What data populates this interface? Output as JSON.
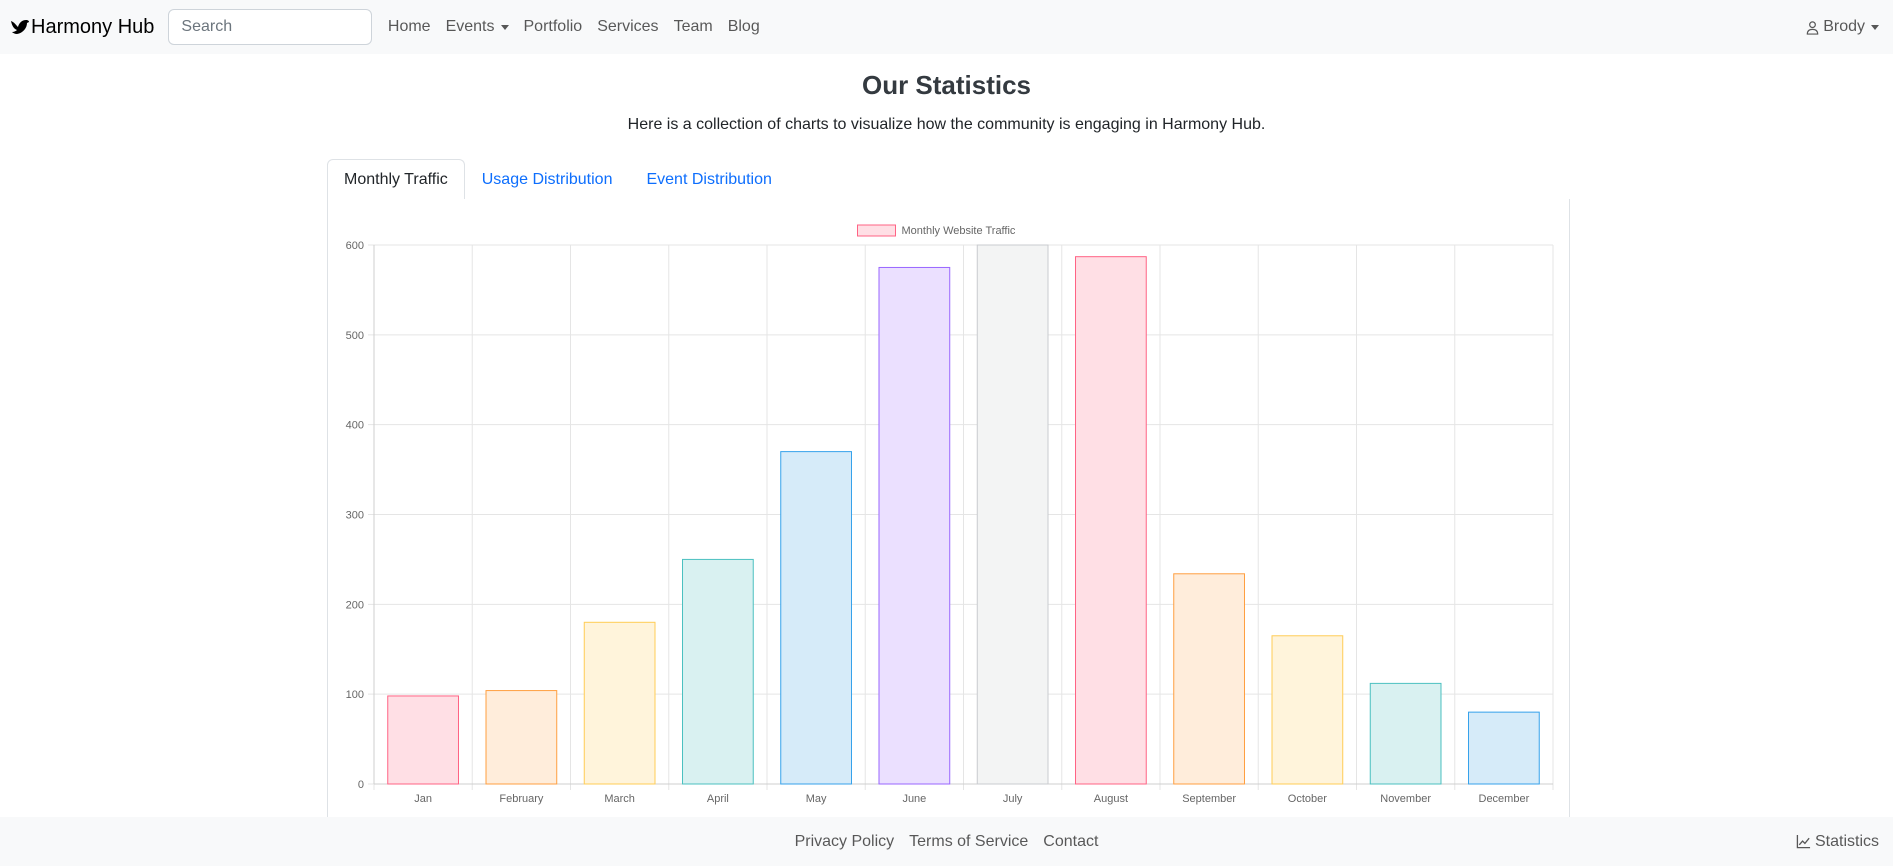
{
  "navbar": {
    "brand": "Harmony Hub",
    "search_placeholder": "Search",
    "links": [
      "Home",
      "Events",
      "Portfolio",
      "Services",
      "Team",
      "Blog"
    ],
    "user": "Brody"
  },
  "header": {
    "title": "Our Statistics",
    "subtitle": "Here is a collection of charts to visualize how the community is engaging in Harmony Hub."
  },
  "tabs": [
    "Monthly Traffic",
    "Usage Distribution",
    "Event Distribution"
  ],
  "footer": {
    "links": [
      "Privacy Policy",
      "Terms of Service",
      "Contact"
    ],
    "statistics": "Statistics"
  },
  "chart_data": {
    "type": "bar",
    "legend": "Monthly Website Traffic",
    "categories": [
      "Jan",
      "February",
      "March",
      "April",
      "May",
      "June",
      "July",
      "August",
      "September",
      "October",
      "November",
      "December"
    ],
    "values": [
      98,
      104,
      180,
      250,
      370,
      575,
      600,
      587,
      234,
      165,
      112,
      80
    ],
    "ylim": [
      0,
      600
    ],
    "yticks": [
      0,
      100,
      200,
      300,
      400,
      500,
      600
    ],
    "grid": true,
    "legend_position": "top",
    "colors": {
      "fill": [
        "#ffdfe5",
        "#ffeddb",
        "#fff4db",
        "#d9f1f1",
        "#d6ebf9",
        "#ebe0ff",
        "#f3f4f4",
        "#ffdfe5",
        "#ffeddb",
        "#fff4db",
        "#d9f1f1",
        "#d6ebf9"
      ],
      "border": [
        "#ff6384",
        "#ff9f40",
        "#ffcd56",
        "#4bc0c0",
        "#36a2eb",
        "#9966ff",
        "#c9cbcf",
        "#ff6384",
        "#ff9f40",
        "#ffcd56",
        "#4bc0c0",
        "#36a2eb"
      ]
    }
  }
}
